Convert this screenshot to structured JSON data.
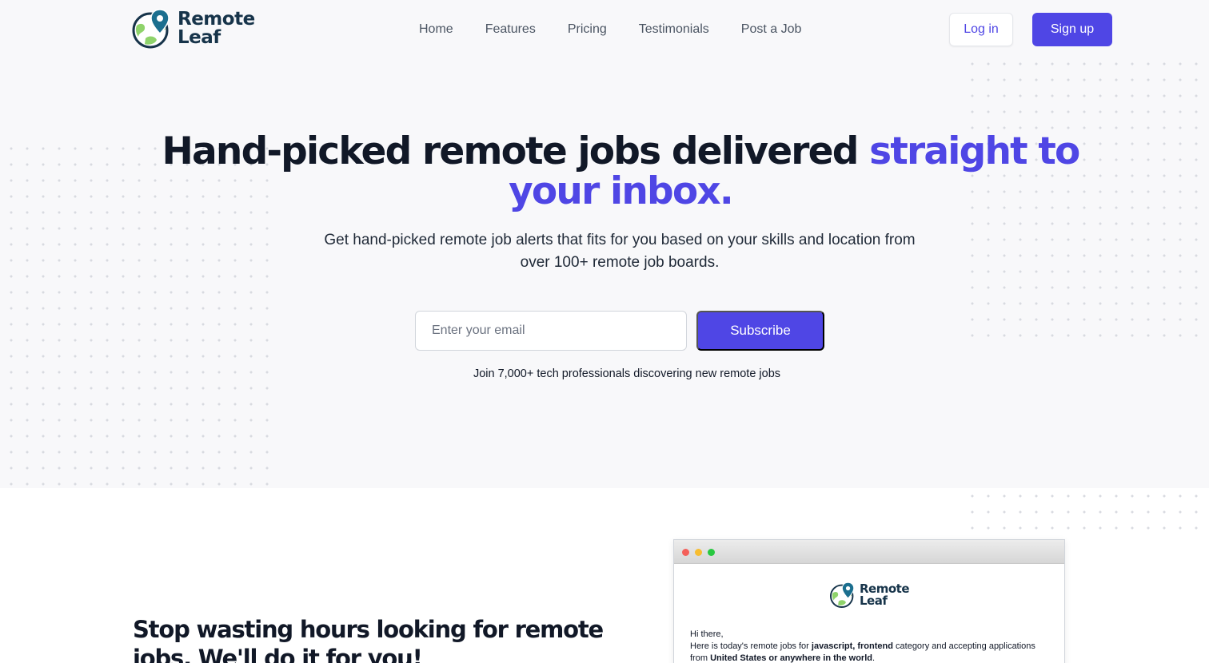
{
  "brand": {
    "line1": "Remote",
    "line2": "Leaf",
    "colors": {
      "primary": "#4f46e5",
      "logo_text": "#17344a",
      "globe_green": "#8fd36b",
      "pin": "#1b6f8f"
    }
  },
  "nav": {
    "links": [
      "Home",
      "Features",
      "Pricing",
      "Testimonials",
      "Post a Job"
    ],
    "login_label": "Log in",
    "signup_label": "Sign up"
  },
  "hero": {
    "headline_dark": "Hand-picked remote jobs delivered ",
    "headline_accent": "straight to your inbox.",
    "subhead": "Get hand-picked remote job alerts that fits for you based on your skills and location from over 100+ remote job boards.",
    "email_placeholder": "Enter your email",
    "subscribe_label": "Subscribe",
    "join_note": "Join 7,000+ tech professionals discovering new remote jobs"
  },
  "section": {
    "title": "Stop wasting hours looking for remote jobs. We'll do it for you!"
  },
  "email_preview": {
    "greeting": "Hi there,",
    "line_prefix": "Here is today's remote jobs for ",
    "categories": "javascript, frontend",
    "line_middle": " category and accepting applications from ",
    "locations": "United States or anywhere in the world",
    "line_end": "."
  },
  "icons": [
    "globe-pin-logo-icon",
    "browser-traffic-lights-icon"
  ]
}
